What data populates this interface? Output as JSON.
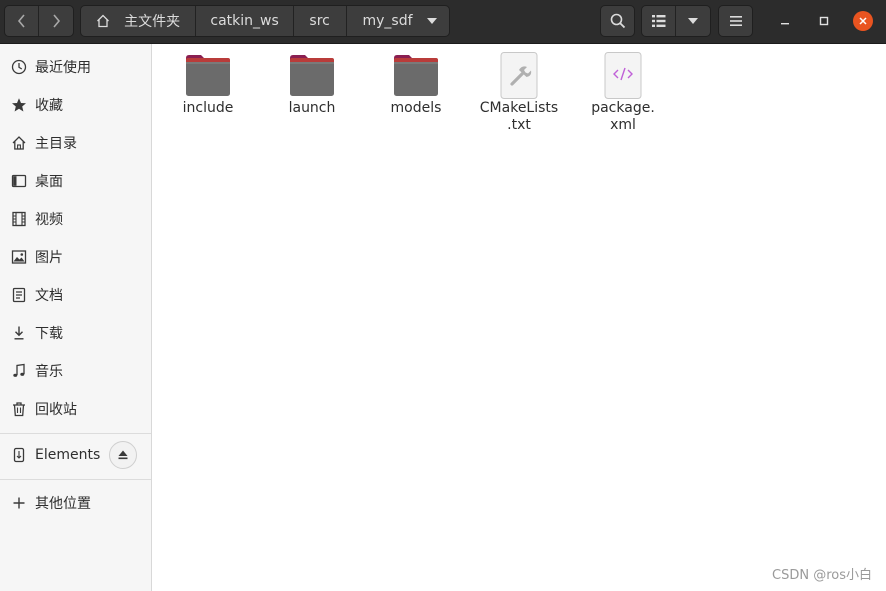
{
  "headerbar": {
    "path": [
      {
        "label": "主文件夹",
        "icon": "home-icon"
      },
      {
        "label": "catkin_ws"
      },
      {
        "label": "src"
      },
      {
        "label": "my_sdf",
        "icon": "chevron-down-icon"
      }
    ],
    "buttons": {
      "back": "back-icon",
      "forward": "forward-icon",
      "search": "search-icon",
      "view": "list-view-icon",
      "view_options": "chevron-down-icon",
      "menu": "hamburger-menu-icon",
      "minimize": "minimize-icon",
      "maximize": "maximize-icon",
      "close": "close-icon"
    },
    "accent_color": "#e95420"
  },
  "sidebar": {
    "items": [
      {
        "label": "最近使用",
        "icon": "clock-icon"
      },
      {
        "label": "收藏",
        "icon": "star-icon"
      },
      {
        "label": "主目录",
        "icon": "home-icon"
      },
      {
        "label": "桌面",
        "icon": "desktop-icon"
      },
      {
        "label": "视频",
        "icon": "video-icon"
      },
      {
        "label": "图片",
        "icon": "picture-icon"
      },
      {
        "label": "文档",
        "icon": "document-icon"
      },
      {
        "label": "下载",
        "icon": "download-icon"
      },
      {
        "label": "音乐",
        "icon": "music-icon"
      },
      {
        "label": "回收站",
        "icon": "trash-icon"
      }
    ],
    "devices": [
      {
        "label": "Elements",
        "icon": "usb-drive-icon",
        "action": "eject-icon"
      }
    ],
    "other": {
      "label": "其他位置",
      "icon": "plus-icon"
    }
  },
  "files": [
    {
      "name": "include",
      "type": "folder"
    },
    {
      "name": "launch",
      "type": "folder"
    },
    {
      "name": "models",
      "type": "folder"
    },
    {
      "name_line1": "CMakeLists",
      "name_line2": ".txt",
      "type": "text"
    },
    {
      "name_line1": "package.",
      "name_line2": "xml",
      "type": "xml"
    }
  ],
  "watermark": "CSDN @ros小白"
}
